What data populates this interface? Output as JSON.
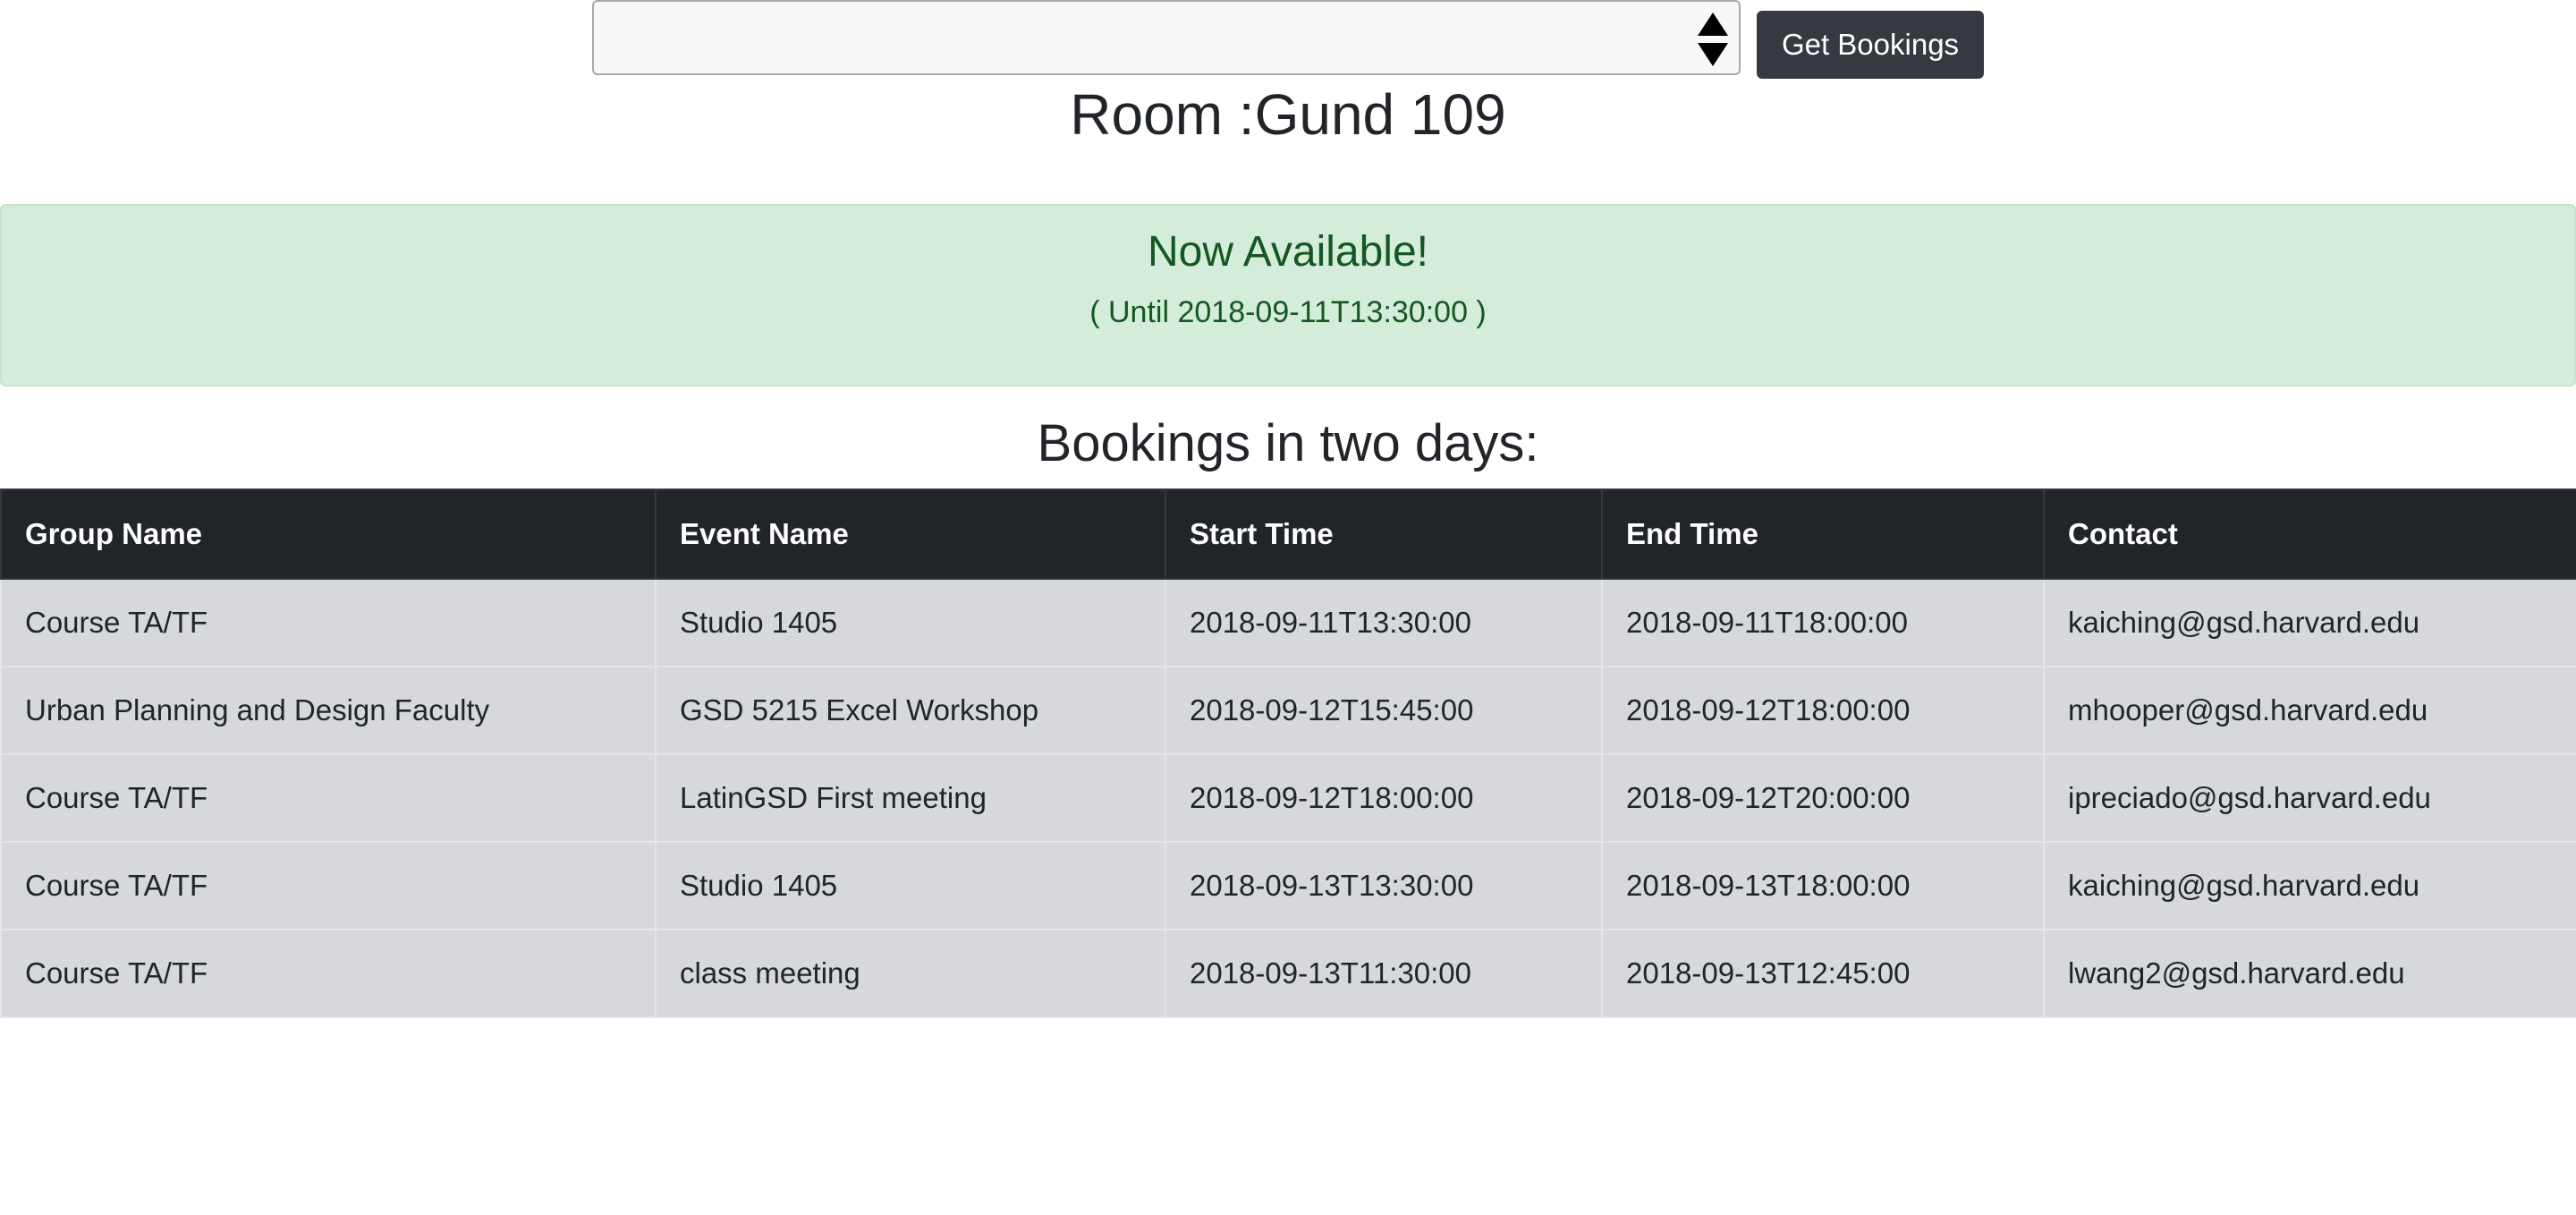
{
  "toolbar": {
    "room_select_value": "",
    "get_bookings_label": "Get Bookings"
  },
  "room_title": "Room :Gund 109",
  "status": {
    "heading": "Now Available!",
    "until_text": "( Until 2018-09-11T13:30:00 )",
    "accent_color": "#155724",
    "background_color": "#d4edda"
  },
  "bookings": {
    "heading": "Bookings in two days:",
    "columns": [
      "Group Name",
      "Event Name",
      "Start Time",
      "End Time",
      "Contact"
    ],
    "rows": [
      [
        "Course TA/TF",
        "Studio 1405",
        "2018-09-11T13:30:00",
        "2018-09-11T18:00:00",
        "kaiching@gsd.harvard.edu"
      ],
      [
        "Urban Planning and Design Faculty",
        "GSD 5215 Excel Workshop",
        "2018-09-12T15:45:00",
        "2018-09-12T18:00:00",
        "mhooper@gsd.harvard.edu"
      ],
      [
        "Course TA/TF",
        "LatinGSD First meeting",
        "2018-09-12T18:00:00",
        "2018-09-12T20:00:00",
        "ipreciado@gsd.harvard.edu"
      ],
      [
        "Course TA/TF",
        "Studio 1405",
        "2018-09-13T13:30:00",
        "2018-09-13T18:00:00",
        "kaiching@gsd.harvard.edu"
      ],
      [
        "Course TA/TF",
        "class meeting",
        "2018-09-13T11:30:00",
        "2018-09-13T12:45:00",
        "lwang2@gsd.harvard.edu"
      ]
    ]
  }
}
